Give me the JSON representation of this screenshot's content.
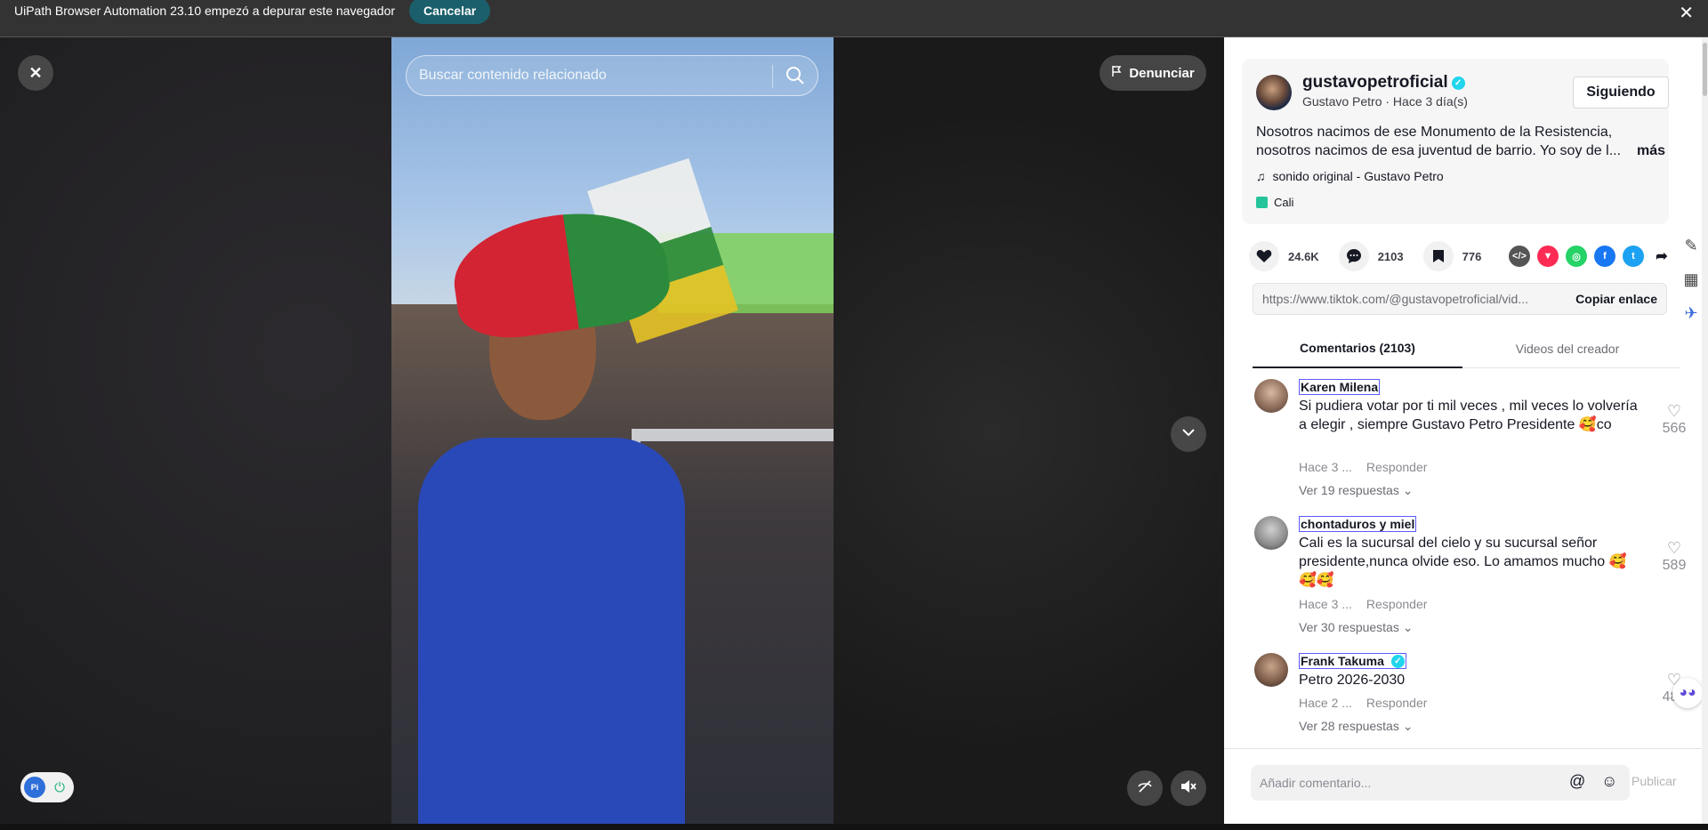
{
  "infobar": {
    "message": "UiPath Browser Automation 23.10 empezó a depurar este navegador",
    "cancel_label": "Cancelar",
    "close_glyph": "✕"
  },
  "player": {
    "search_placeholder": "Buscar contenido relacionado",
    "report_label": "Denunciar",
    "close_glyph": "✕",
    "next_glyph": "⌄"
  },
  "post": {
    "username": "gustavopetroficial",
    "display_name_time": "Gustavo Petro · Hace 3 día(s)",
    "follow_label": "Siguiendo",
    "description": "Nosotros nacimos de ese Monumento de la Resistencia, nosotros nacimos de esa juventud de barrio. Yo soy de l...",
    "more_label": "más",
    "music": "sonido original - Gustavo Petro",
    "location": "Cali",
    "likes": "24.6K",
    "comments": "2103",
    "saves": "776",
    "url": "https://www.tiktok.com/@gustavopetroficial/vid...",
    "copy_label": "Copiar enlace"
  },
  "tabs": {
    "comments": "Comentarios (2103)",
    "creator_videos": "Videos del creador"
  },
  "comments": [
    {
      "name": "Karen Milena",
      "text": "Si pudiera votar por ti mil veces , mil veces lo volvería a elegir , siempre Gustavo Petro Presidente 🥰co",
      "time": "Hace 3 ...",
      "reply": "Responder",
      "replies": "Ver 19 respuestas",
      "likes": "566"
    },
    {
      "name": "chontaduros y miel",
      "text": "Cali es la sucursal del cielo y su sucursal señor presidente,nunca olvide eso. Lo amamos mucho 🥰🥰🥰",
      "time": "Hace 3 ...",
      "reply": "Responder",
      "replies": "Ver 30 respuestas",
      "likes": "589"
    },
    {
      "name": "Frank Takuma",
      "text": "Petro 2026-2030",
      "time": "Hace 2 ...",
      "reply": "Responder",
      "replies": "Ver 28 respuestas",
      "likes": "486"
    }
  ],
  "composer": {
    "placeholder": "Añadir comentario...",
    "publish_label": "Publicar"
  },
  "colors": {
    "infobar_bg": "#333333",
    "cancel_bg": "#1a5f6b",
    "verified": "#20d5ec",
    "highlight_border": "#5b5bff"
  }
}
